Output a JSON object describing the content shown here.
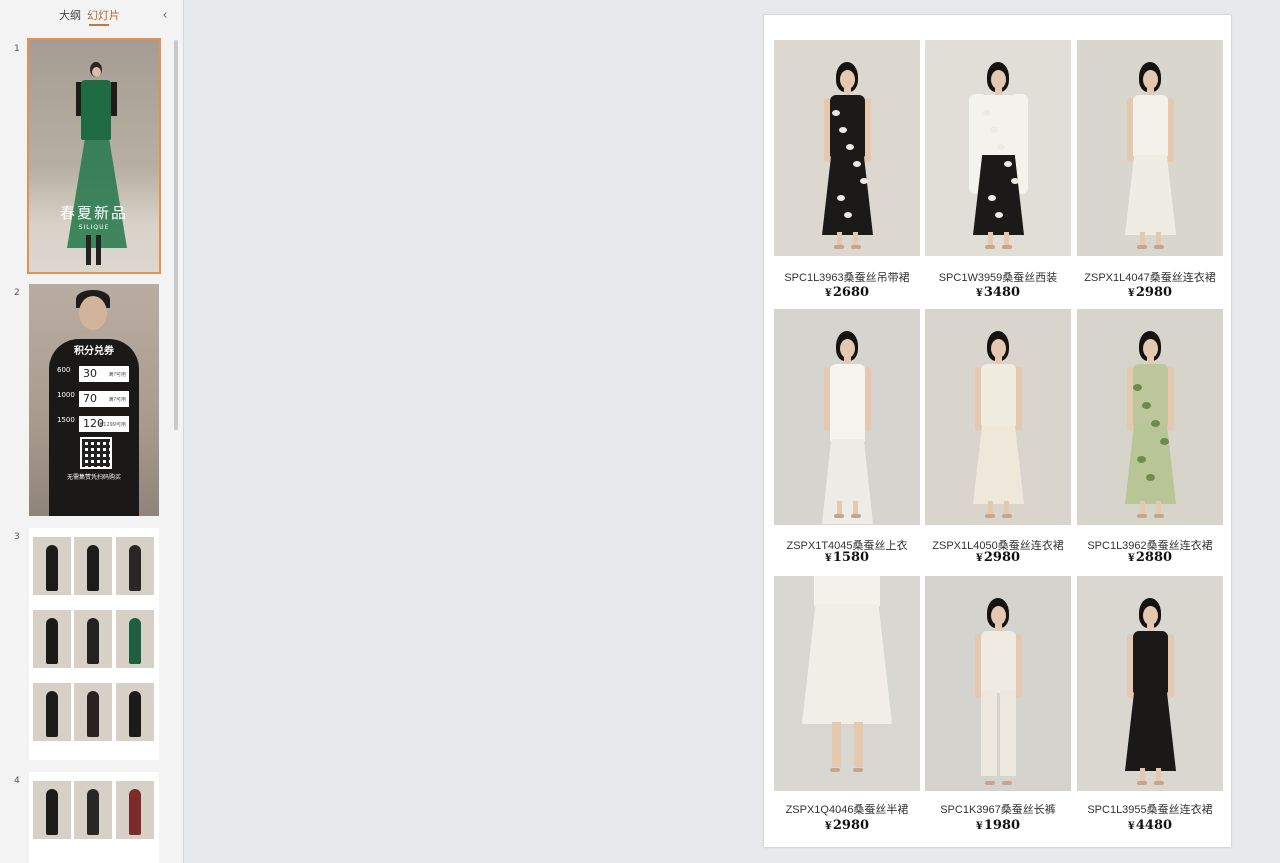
{
  "panel": {
    "tabs": {
      "outline": "大纲",
      "slides": "幻灯片"
    },
    "collapse_icon": "chevron-left-icon",
    "slide_numbers": [
      "1",
      "2",
      "3",
      "4"
    ],
    "thumb1": {
      "title": "春夏新品",
      "brand": "SILIQUE"
    },
    "thumb2": {
      "title": "积分兑券",
      "rows": [
        {
          "points": "600",
          "value": "30",
          "note": "满?可用"
        },
        {
          "points": "1000",
          "value": "70",
          "note": "满?可用"
        },
        {
          "points": "1500",
          "value": "120",
          "note": "满1299可用"
        }
      ],
      "caption": "无需集赞凭扫码购买"
    }
  },
  "slide": {
    "products": [
      {
        "name": "SPC1L3963桑蚕丝吊带裙",
        "currency": "¥",
        "price": "2680"
      },
      {
        "name": "SPC1W3959桑蚕丝西装",
        "currency": "¥",
        "price": "3480"
      },
      {
        "name": "ZSPX1L4047桑蚕丝连衣裙",
        "currency": "¥",
        "price": "2980"
      },
      {
        "name": "ZSPX1T4045桑蚕丝上衣",
        "currency": "¥",
        "price": "1580"
      },
      {
        "name": "ZSPX1L4050桑蚕丝连衣裙",
        "currency": "¥",
        "price": "2980"
      },
      {
        "name": "SPC1L3962桑蚕丝连衣裙",
        "currency": "¥",
        "price": "2880"
      },
      {
        "name": "ZSPX1Q4046桑蚕丝半裙",
        "currency": "¥",
        "price": "2980"
      },
      {
        "name": "SPC1K3967桑蚕丝长裤",
        "currency": "¥",
        "price": "1980"
      },
      {
        "name": "SPC1L3955桑蚕丝连衣裙",
        "currency": "¥",
        "price": "4480"
      }
    ]
  },
  "colors": {
    "accent": "#c27a3e",
    "selected_outline": "#e5914f"
  }
}
